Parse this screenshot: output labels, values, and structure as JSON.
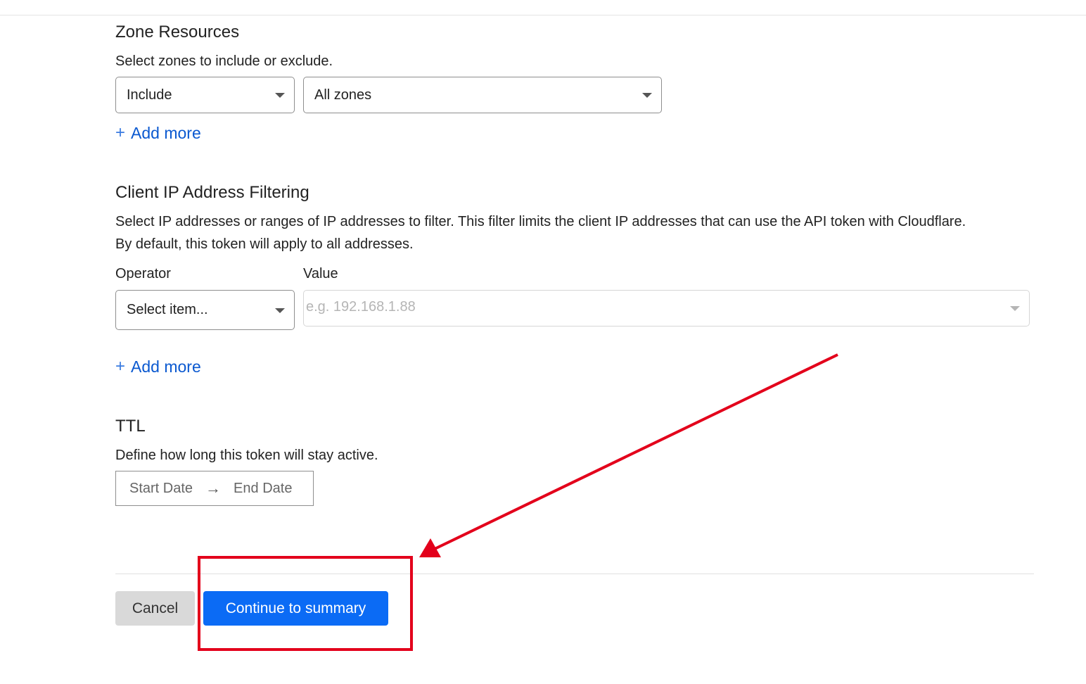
{
  "zone_resources": {
    "title": "Zone Resources",
    "description": "Select zones to include or exclude.",
    "mode_select": {
      "value": "Include"
    },
    "zone_select": {
      "value": "All zones"
    },
    "add_more_label": "Add more"
  },
  "ip_filtering": {
    "title": "Client IP Address Filtering",
    "description": "Select IP addresses or ranges of IP addresses to filter. This filter limits the client IP addresses that can use the API token with Cloudflare. By default, this token will apply to all addresses.",
    "operator_label": "Operator",
    "value_label": "Value",
    "operator_select": {
      "value": "Select item..."
    },
    "value_input": {
      "placeholder": "e.g. 192.168.1.88"
    },
    "add_more_label": "Add more"
  },
  "ttl": {
    "title": "TTL",
    "description": "Define how long this token will stay active.",
    "start_placeholder": "Start Date",
    "end_placeholder": "End Date"
  },
  "footer": {
    "cancel_label": "Cancel",
    "continue_label": "Continue to summary"
  },
  "colors": {
    "primary": "#0b6bf5",
    "link": "#0b59d0",
    "annotation": "#e3001b"
  }
}
